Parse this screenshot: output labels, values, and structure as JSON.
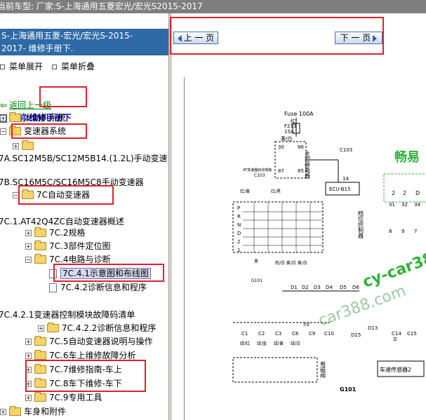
{
  "topbar": {
    "label": "当前车型:",
    "value": "厂家:S-上海通用五菱宏光/宏光S2015-2017"
  },
  "left_panel": {
    "title_line1": "S-上海通用五菱-宏光/宏光S-2015-",
    "title_line2": "2017- 维修手册下.",
    "expand_label": "菜单展开",
    "collapse_label": "菜单折叠",
    "back_label": "返回上一级",
    "current_label": "当前:维修手册下"
  },
  "tree": [
    {
      "label": "发动机系统"
    },
    {
      "label": "变速器系统"
    },
    {
      "label": ""
    },
    {
      "label": "7A.SC12M5B/SC12M5B14.(1.2L)手动变速"
    },
    {
      "label": "7B.SC16M5C/SC16M5C8手动变速器"
    },
    {
      "label": "7C自动变速器"
    },
    {
      "label": "7C.1.AT42Q4ZC自动变速器概述"
    },
    {
      "label": "7C.2规格"
    },
    {
      "label": "7C.3部件定位图"
    },
    {
      "label": "7C.4电路与诊断"
    },
    {
      "label": "7C.4.1示意图和布线图"
    },
    {
      "label": "7C.4.2诊断信息和程序"
    },
    {
      "label": "7C.4.2.1变速器控制模块故障码清单"
    },
    {
      "label": "7C.4.2.2诊断信息和程序"
    },
    {
      "label": "7C.5自动变速器说明与操作"
    },
    {
      "label": "7C.6车上维修故障分析"
    },
    {
      "label": "7C.7维修指南-车上"
    },
    {
      "label": "7C.8车下维修-车下"
    },
    {
      "label": "7C.9专用工具"
    },
    {
      "label": "车身和附件"
    }
  ],
  "nav": {
    "prev_label": "上 一 页",
    "next_label": "下 一 页"
  },
  "diagram_text": {
    "fuse": "Fuse 100A",
    "fuse_color": "红",
    "f213": "F213",
    "f213_amp": "15A",
    "relay": "主控继电器",
    "c103": "C103",
    "c103b": "C103",
    "ecu": "ECU-B15",
    "pin14": "14",
    "at_ctrl": "AT变速器启动电路",
    "yellow_white": "黄/白",
    "green_black": "绿/黑",
    "wire_87": "87",
    "wire_86": "86",
    "wire_30": "30",
    "wire_85": "85",
    "wire_white_red": "白/红",
    "red_yellow": "红/黄",
    "red_black": "红/黑",
    "gear_p": "P",
    "gear_r": "R",
    "gear_n": "N",
    "gear_d": "D",
    "gear_2": "2",
    "gear_1": "1",
    "gear_switch": "档位控制器",
    "black": "黑",
    "g101": "G101",
    "g101b": "G101",
    "mid_wires": "棕/白 黄/红 黄/白",
    "diodes": [
      "D1",
      "D2",
      "D3",
      "D4",
      "D5",
      "D6"
    ],
    "conn": [
      "C1",
      "C2",
      "C3",
      "C8",
      "C9",
      "C10"
    ],
    "conn_colors": [
      "绿/红",
      "绿/蓝",
      "绿/黄",
      "绿/白"
    ],
    "v5": "5V",
    "solenoid": "电磁阀",
    "d15": "D15",
    "d13": "D13",
    "c14": "C14",
    "c15": "C15",
    "white": "白",
    "speed_sensor": "车速传感器2",
    "right_pins": [
      "31",
      "32",
      "34"
    ],
    "right_pins2": [
      "8",
      "9",
      "7"
    ],
    "right_box": [
      "2",
      "2",
      "D"
    ],
    "watermark1": "畅易",
    "watermark2": "cy-car388",
    "watermark3": "car388.com"
  }
}
